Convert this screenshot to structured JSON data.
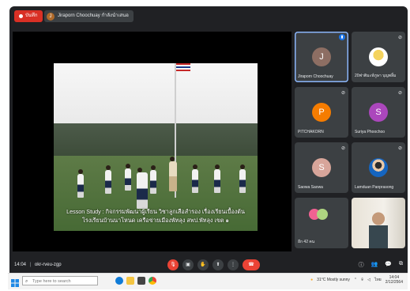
{
  "topbar": {
    "recording_label": "บันทึก",
    "presenter_initial": "J",
    "presenter_label": "Jiraporn Choochuay กำลังนำเสนอ"
  },
  "video": {
    "caption_line1": "Lesson Study : กิจกรรมพัฒนาผู้เรียน วิชาลูกเสือสำรอง เรื่องเรียนเบื้องต้น",
    "caption_line2": "โรงเรียนบ้านนาโหนด เครือข่ายเมืองพัทลุง สพป.พัทลุง เขต ๑"
  },
  "participants": [
    {
      "name": "Jiraporn Choochuay",
      "initial": "J",
      "color": "#8d6e63",
      "speaking": true
    },
    {
      "name": "20ฟาติมะห์ภูษา บุญพลิ้ม",
      "photo": true
    },
    {
      "name": "PITCHAKORN",
      "initial": "P",
      "color": "#f57c00"
    },
    {
      "name": "Suriya Phoochoo",
      "initial": "S",
      "color": "#ab47bc"
    },
    {
      "name": "Saowa Saowa",
      "initial": "S",
      "color": "#d7a59a"
    },
    {
      "name": "Lamduan Panprasong",
      "photo": true
    },
    {
      "name": "อีก 42 คน",
      "group": true
    },
    {
      "name": "",
      "camera": true
    }
  ],
  "controls": {
    "clock": "14:04",
    "meeting_code": "okr-rveu-zgp",
    "buttons": [
      "mic-off",
      "camera-off",
      "raise-hand",
      "present",
      "more",
      "hang-up"
    ],
    "right": [
      "info",
      "people",
      "chat",
      "activities"
    ]
  },
  "taskbar": {
    "search_placeholder": "Type here to search",
    "weather": "31°C Mostly sunny",
    "lang": "ไทย",
    "time": "14:04",
    "date": "2/12/2564"
  },
  "colors": {
    "background": "#202124",
    "tile": "#3c4043",
    "record": "#d93025",
    "hangup": "#ea4335",
    "active_border": "#8ab4f8"
  }
}
